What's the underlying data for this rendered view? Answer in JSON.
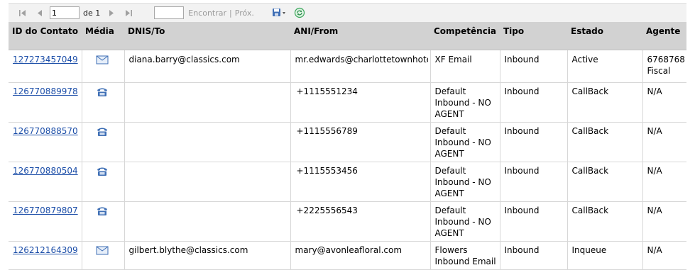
{
  "toolbar": {
    "first_page_icon": "first-page-icon",
    "prev_page_icon": "prev-page-icon",
    "page_value": "1",
    "of_text": "de 1",
    "next_page_icon": "next-page-icon",
    "last_page_icon": "last-page-icon",
    "find_value": "",
    "find_label": "Encontrar",
    "separator": "|",
    "next_label": "Próx.",
    "export_icon": "save-export-icon",
    "refresh_icon": "refresh-icon"
  },
  "table": {
    "headers": [
      "ID do Contato",
      "Média",
      "DNIS/To",
      "ANI/From",
      "Competência",
      "Tipo",
      "Estado",
      "Agente"
    ],
    "rows": [
      {
        "id": "127273457049",
        "media": "email-icon",
        "dnis": "diana.barry@classics.com",
        "ani": "mr.edwards@charlottetownhote",
        "skill": "XF Email",
        "type": "Inbound",
        "state": "Active",
        "agent": "6768768 Fiscal"
      },
      {
        "id": "126770889978",
        "media": "phone-icon",
        "dnis": "",
        "ani": "+1115551234",
        "skill": "Default Inbound - NO AGENT",
        "type": "Inbound",
        "state": "CallBack",
        "agent": "N/A"
      },
      {
        "id": "126770888570",
        "media": "phone-icon",
        "dnis": "",
        "ani": "+1115556789",
        "skill": "Default Inbound - NO AGENT",
        "type": "Inbound",
        "state": "CallBack",
        "agent": "N/A"
      },
      {
        "id": "126770880504",
        "media": "phone-icon",
        "dnis": "",
        "ani": "+1115553456",
        "skill": "Default Inbound - NO AGENT",
        "type": "Inbound",
        "state": "CallBack",
        "agent": "N/A"
      },
      {
        "id": "126770879807",
        "media": "phone-icon",
        "dnis": "",
        "ani": "+2225556543",
        "skill": "Default Inbound - NO AGENT",
        "type": "Inbound",
        "state": "CallBack",
        "agent": "N/A"
      },
      {
        "id": "126212164309",
        "media": "email-icon",
        "dnis": "gilbert.blythe@classics.com",
        "ani": "mary@avonleafloral.com",
        "skill": "Flowers Inbound Email",
        "type": "Inbound",
        "state": "Inqueue",
        "agent": "N/A"
      }
    ]
  },
  "colors": {
    "header_bg": "#d2d2d2",
    "toolbar_bg": "#f2f2f2",
    "link": "#1c4ea8",
    "icon_blue": "#3f6fb5"
  }
}
